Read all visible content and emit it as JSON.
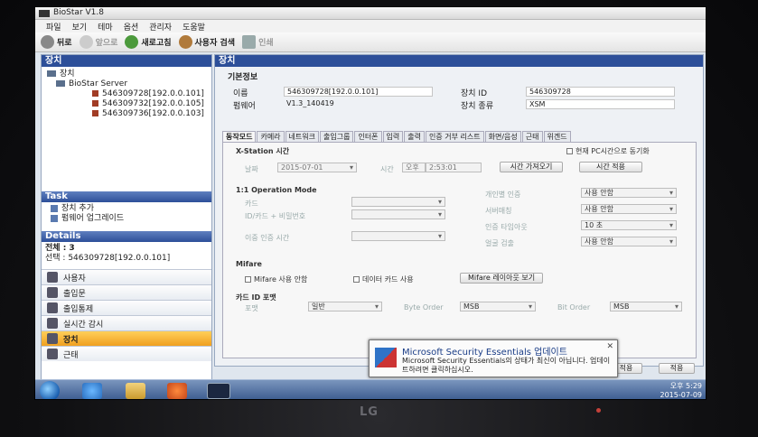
{
  "window": {
    "title": "BioStar V1.8"
  },
  "menu": [
    "파일",
    "보기",
    "테마",
    "옵션",
    "관리자",
    "도움말"
  ],
  "toolbar": {
    "back": "뒤로",
    "forward": "앞으로",
    "refresh": "새로고침",
    "user_search": "사용자 검색",
    "print": "인쇄"
  },
  "left": {
    "header": "장치",
    "tree": {
      "root": "장치",
      "server": "BioStar Server",
      "devices": [
        "546309728[192.0.0.101]",
        "546309732[192.0.0.105]",
        "546309736[192.0.0.103]"
      ]
    },
    "task_header": "Task",
    "tasks": [
      "장치 추가",
      "펌웨어 업그레이드"
    ],
    "details_header": "Details",
    "details_total": "전체 : 3",
    "details_selected": "선택 : 546309728[192.0.0.101]",
    "nav": [
      "사용자",
      "출입문",
      "출입통제",
      "실시간 감시",
      "장치",
      "근태"
    ]
  },
  "main": {
    "header": "장치",
    "basic_title": "기본정보",
    "name_label": "이름",
    "name_value": "546309728[192.0.0.101]",
    "firmware_label": "펌웨어",
    "firmware_value": "V1.3_140419",
    "device_id_label": "장치 ID",
    "device_id_value": "546309728",
    "device_type_label": "장치 종류",
    "device_type_value": "XSM",
    "tabs": [
      "동작모드",
      "카메라",
      "네트워크",
      "출입그룹",
      "인터폰",
      "입력",
      "출력",
      "인증 거부 리스트",
      "화면/음성",
      "근태",
      "위겐드"
    ],
    "xstation_time": "X-Station 시간",
    "sync_pc_time": "현재 PC시간으로 동기화",
    "date_label": "날짜",
    "date_value": "2015-07-01",
    "time_label": "시간",
    "ampm": "오후",
    "time_value": "2:53:01",
    "get_time_btn": "시간 가져오기",
    "apply_time_btn": "시간 적용",
    "op_mode_title": "1:1 Operation Mode",
    "card_label": "카드",
    "id_card_pw_label": "ID/카드 + 비밀번호",
    "dual_auth_label": "이중 인증 시간",
    "individual_auth_label": "개인별 인증",
    "server_match_label": "서버매칭",
    "auth_timeout_label": "인증 타임아웃",
    "face_detect_label": "얼굴 검출",
    "individual_auth_value": "사용 안함",
    "server_match_value": "사용 안함",
    "auth_timeout_value": "10 초",
    "face_detect_value": "사용 안함",
    "mifare_title": "Mifare",
    "mifare_unused": "Mifare 사용 안함",
    "data_card_use": "데이터 카드 사용",
    "mifare_layout_btn": "Mifare 레이아웃 보기",
    "card_id_format_title": "카드 ID 포맷",
    "format_label": "포맷",
    "format_value": "일반",
    "byte_order_label": "Byte Order",
    "byte_order_value": "MSB",
    "bit_order_label": "Bit Order",
    "bit_order_value": "MSB",
    "bottom_btn1": "적용",
    "bottom_btn2": "적용"
  },
  "notification": {
    "title": "Microsoft Security Essentials 업데이트",
    "body": "Microsoft Security Essentials의 상태가 최신이 아닙니다. 업데이트하려면 클릭하십시오."
  },
  "taskbar": {
    "time": "오후 5:29",
    "date": "2015-07-09"
  },
  "monitor_brand": "LG"
}
